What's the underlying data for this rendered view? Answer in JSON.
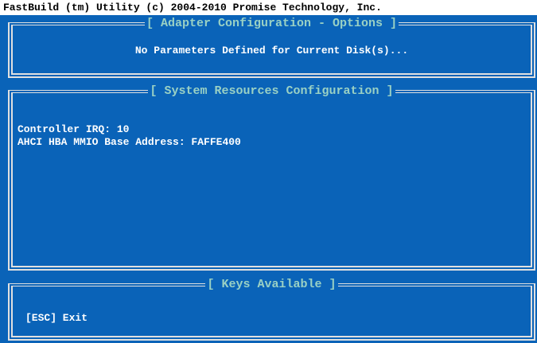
{
  "header": {
    "title": "FastBuild (tm) Utility (c) 2004-2010 Promise Technology, Inc."
  },
  "adapter_panel": {
    "title": "[ Adapter Configuration - Options ]",
    "message": "No Parameters Defined for Current Disk(s)..."
  },
  "resources_panel": {
    "title": "[ System Resources Configuration ]",
    "lines": [
      "Controller IRQ: 10",
      "AHCI HBA MMIO Base Address: FAFFE400"
    ]
  },
  "keys_panel": {
    "title": "[ Keys Available ]",
    "esc_label": "[ESC] Exit"
  },
  "colors": {
    "background": "#0a63b8",
    "frame": "#e0e0e0",
    "panel_title": "#9ad1c4",
    "text": "#ffffff"
  }
}
